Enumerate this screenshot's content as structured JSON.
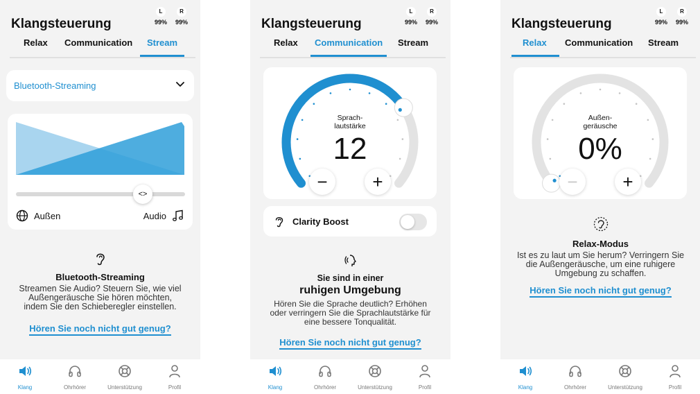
{
  "colors": {
    "accent": "#1f8fd0",
    "light_blue": "#a9d5ef",
    "track_gray": "#e3e3e3",
    "background": "#f3f3f3"
  },
  "header": {
    "title": "Klangsteuerung",
    "battery": {
      "left_label": "L",
      "left_value": "99%",
      "right_label": "R",
      "right_value": "99%"
    }
  },
  "tabs": [
    "Relax",
    "Communication",
    "Stream"
  ],
  "bottom_nav": [
    {
      "label": "Klang",
      "icon": "speaker-icon"
    },
    {
      "label": "Ohrhörer",
      "icon": "headphones-icon"
    },
    {
      "label": "Unterstützung",
      "icon": "lifebuoy-icon"
    },
    {
      "label": "Profil",
      "icon": "person-icon"
    }
  ],
  "help_link": "Hören Sie noch nicht gut genug?",
  "stream_screen": {
    "active_tab": "Stream",
    "dropdown_value": "Bluetooth-Streaming",
    "mix_slider_position": 0.75,
    "slider_left_label": "Außen",
    "slider_right_label": "Audio",
    "info_title": "Bluetooth-Streaming",
    "info_text": "Streamen Sie Audio? Steuern Sie, wie viel Außengeräusche Sie hören möchten, indem Sie den Schieberegler einstellen."
  },
  "communication_screen": {
    "active_tab": "Communication",
    "gauge_label_line1": "Sprach-",
    "gauge_label_line2": "lautstärke",
    "gauge_value": "12",
    "gauge_level": 0.72,
    "minus_symbol": "−",
    "plus_symbol": "+",
    "clarity_boost_label": "Clarity Boost",
    "clarity_boost_on": false,
    "info_line1": "Sie sind in einer",
    "info_line2": "ruhigen Umgebung",
    "info_text": "Hören Sie die Sprache deutlich? Erhöhen oder verringern Sie die Sprachlautstärke für eine bessere Tonqualität."
  },
  "relax_screen": {
    "active_tab": "Relax",
    "gauge_label_line1": "Außen-",
    "gauge_label_line2": "geräusche",
    "gauge_value": "0%",
    "gauge_level": 0.0,
    "minus_symbol": "−",
    "plus_symbol": "+",
    "info_title": "Relax-Modus",
    "info_text": "Ist es zu laut um Sie herum? Verringern Sie die Außengeräusche, um eine ruhigere Umgebung zu schaffen."
  }
}
